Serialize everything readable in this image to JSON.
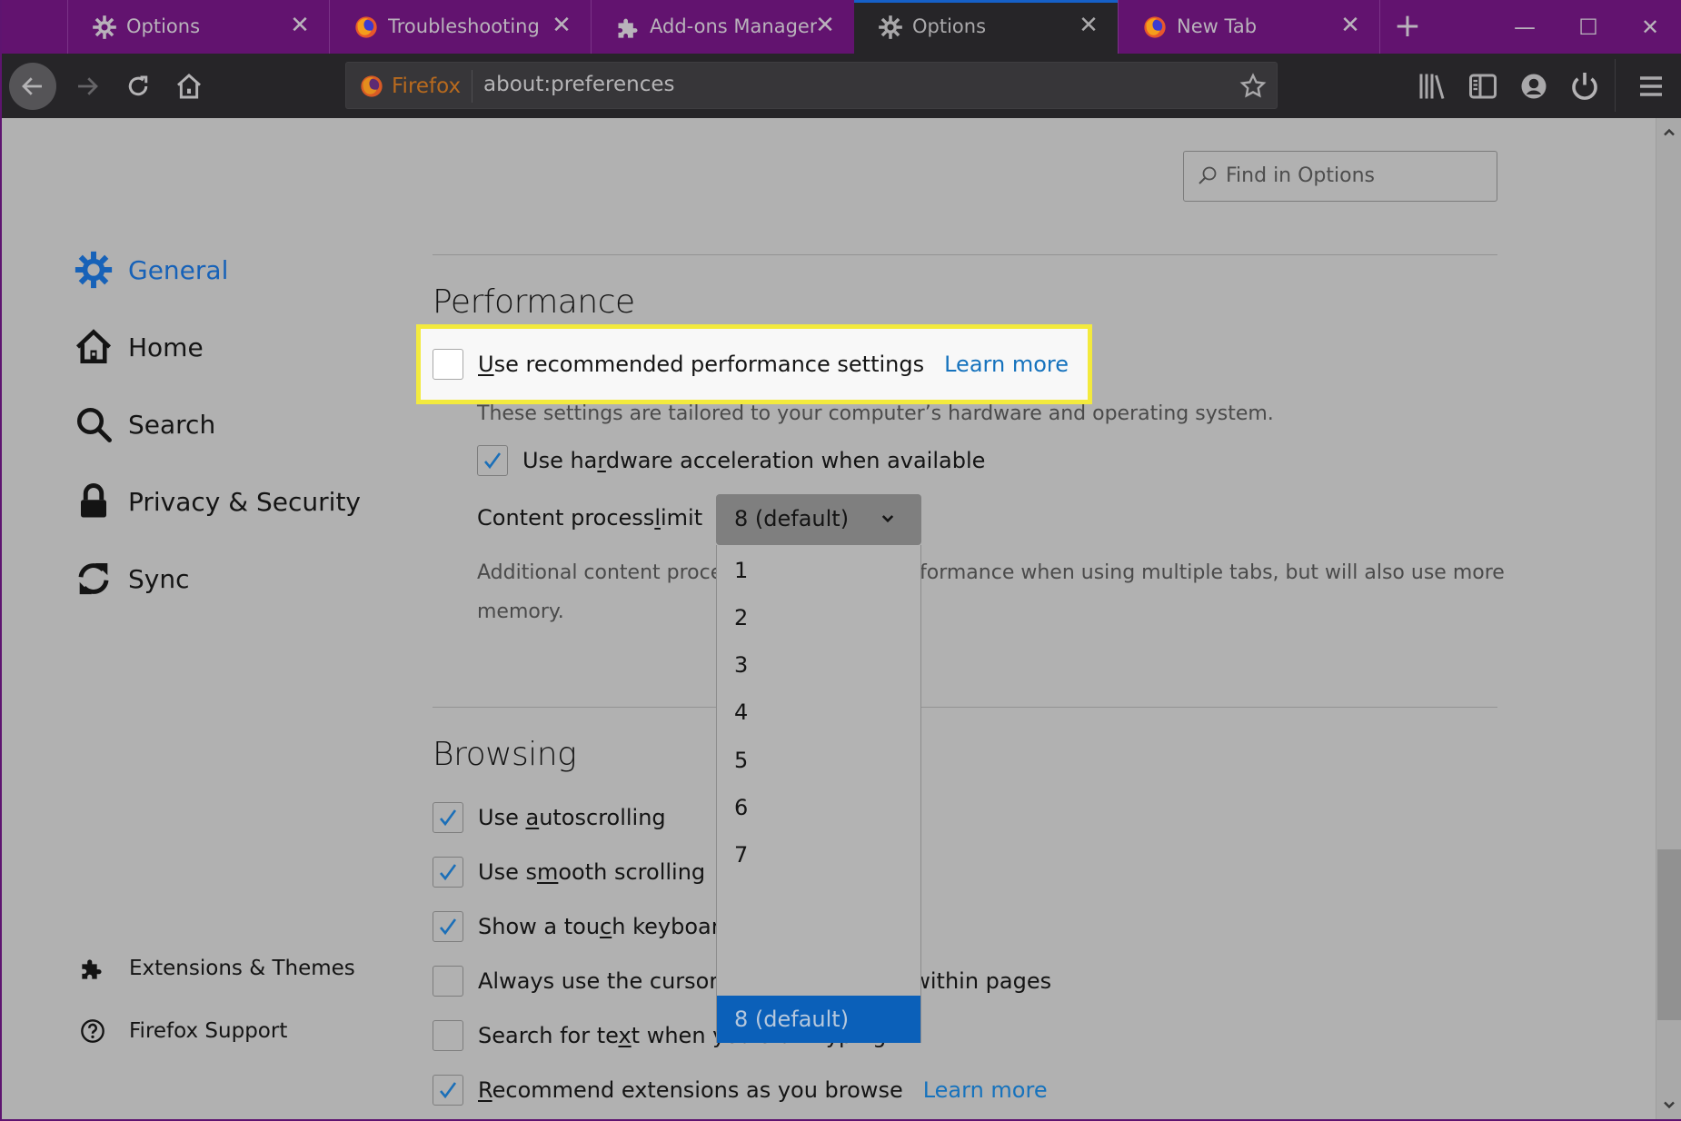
{
  "tabs": [
    {
      "label": "Options",
      "icon": "gear-icon",
      "active": false
    },
    {
      "label": "Troubleshooting Inf",
      "icon": "firefox-icon",
      "active": false
    },
    {
      "label": "Add-ons Manager",
      "icon": "puzzle-icon",
      "active": false
    },
    {
      "label": "Options",
      "icon": "gear-icon",
      "active": true
    },
    {
      "label": "New Tab",
      "icon": "firefox-icon",
      "active": false
    }
  ],
  "tab_close_glyph": "✕",
  "new_tab_glyph": "+",
  "window_controls": {
    "minimize": "—",
    "maximize": "☐",
    "close": "✕"
  },
  "urlbar": {
    "identity_label": "Firefox",
    "url": "about:preferences"
  },
  "sidebar": {
    "items": [
      {
        "label": "General",
        "icon": "gear-icon",
        "active": true
      },
      {
        "label": "Home",
        "icon": "home-icon",
        "active": false
      },
      {
        "label": "Search",
        "icon": "search-icon",
        "active": false
      },
      {
        "label": "Privacy & Security",
        "icon": "lock-icon",
        "active": false
      },
      {
        "label": "Sync",
        "icon": "sync-icon",
        "active": false
      }
    ],
    "footer": [
      {
        "label": "Extensions & Themes",
        "icon": "puzzle-icon"
      },
      {
        "label": "Firefox Support",
        "icon": "help-icon"
      }
    ]
  },
  "find": {
    "placeholder": "Find in Options"
  },
  "performance": {
    "heading": "Performance",
    "recommended": {
      "label_u": "U",
      "label_rest": "se recommended performance settings",
      "checked": false,
      "link": "Learn more"
    },
    "recommended_desc": "These settings are tailored to your computer’s hardware and operating system.",
    "hw_accel": {
      "label_pre": "Use ha",
      "label_u": "r",
      "label_rest": "dware acceleration when available",
      "checked": true
    },
    "process_limit": {
      "label_pre": "Content process ",
      "label_u": "l",
      "label_rest": "imit",
      "value": "8 (default)",
      "options": [
        "1",
        "2",
        "3",
        "4",
        "5",
        "6",
        "7",
        "8 (default)"
      ],
      "selected_index": 7
    },
    "process_desc_1": "Additional content processes can improve performance when using multiple tabs, but will also use more",
    "process_desc_1a": "Additional content proce",
    "process_desc_1b": "formance when using multiple tabs, but will also use more",
    "process_desc_2": "memory."
  },
  "browsing": {
    "heading": "Browsing",
    "options": [
      {
        "pre": "Use ",
        "u": "a",
        "rest": "utoscrolling",
        "checked": true
      },
      {
        "pre": "Use s",
        "u": "m",
        "rest": "ooth scrolling",
        "checked": true
      },
      {
        "pre": "Show a tou",
        "u": "c",
        "rest": "h keyboard when necessary",
        "checked": true
      },
      {
        "pre": "Always use the cursor ",
        "u": "k",
        "rest": "eys to navigate within pages",
        "checked": false
      },
      {
        "pre": "Search for te",
        "u": "x",
        "rest": "t when you start typing",
        "checked": false
      },
      {
        "pre": "",
        "u": "R",
        "rest": "ecommend extensions as you browse",
        "checked": true,
        "link": "Learn more"
      }
    ]
  },
  "colors": {
    "tabbar": "#62136f",
    "toolbar": "#262528",
    "content_bg": "#b1b1b1",
    "accent": "#1762b8",
    "link": "#1572bd",
    "highlight_border": "#f3ea3d",
    "selected_option": "#0b60b9"
  }
}
